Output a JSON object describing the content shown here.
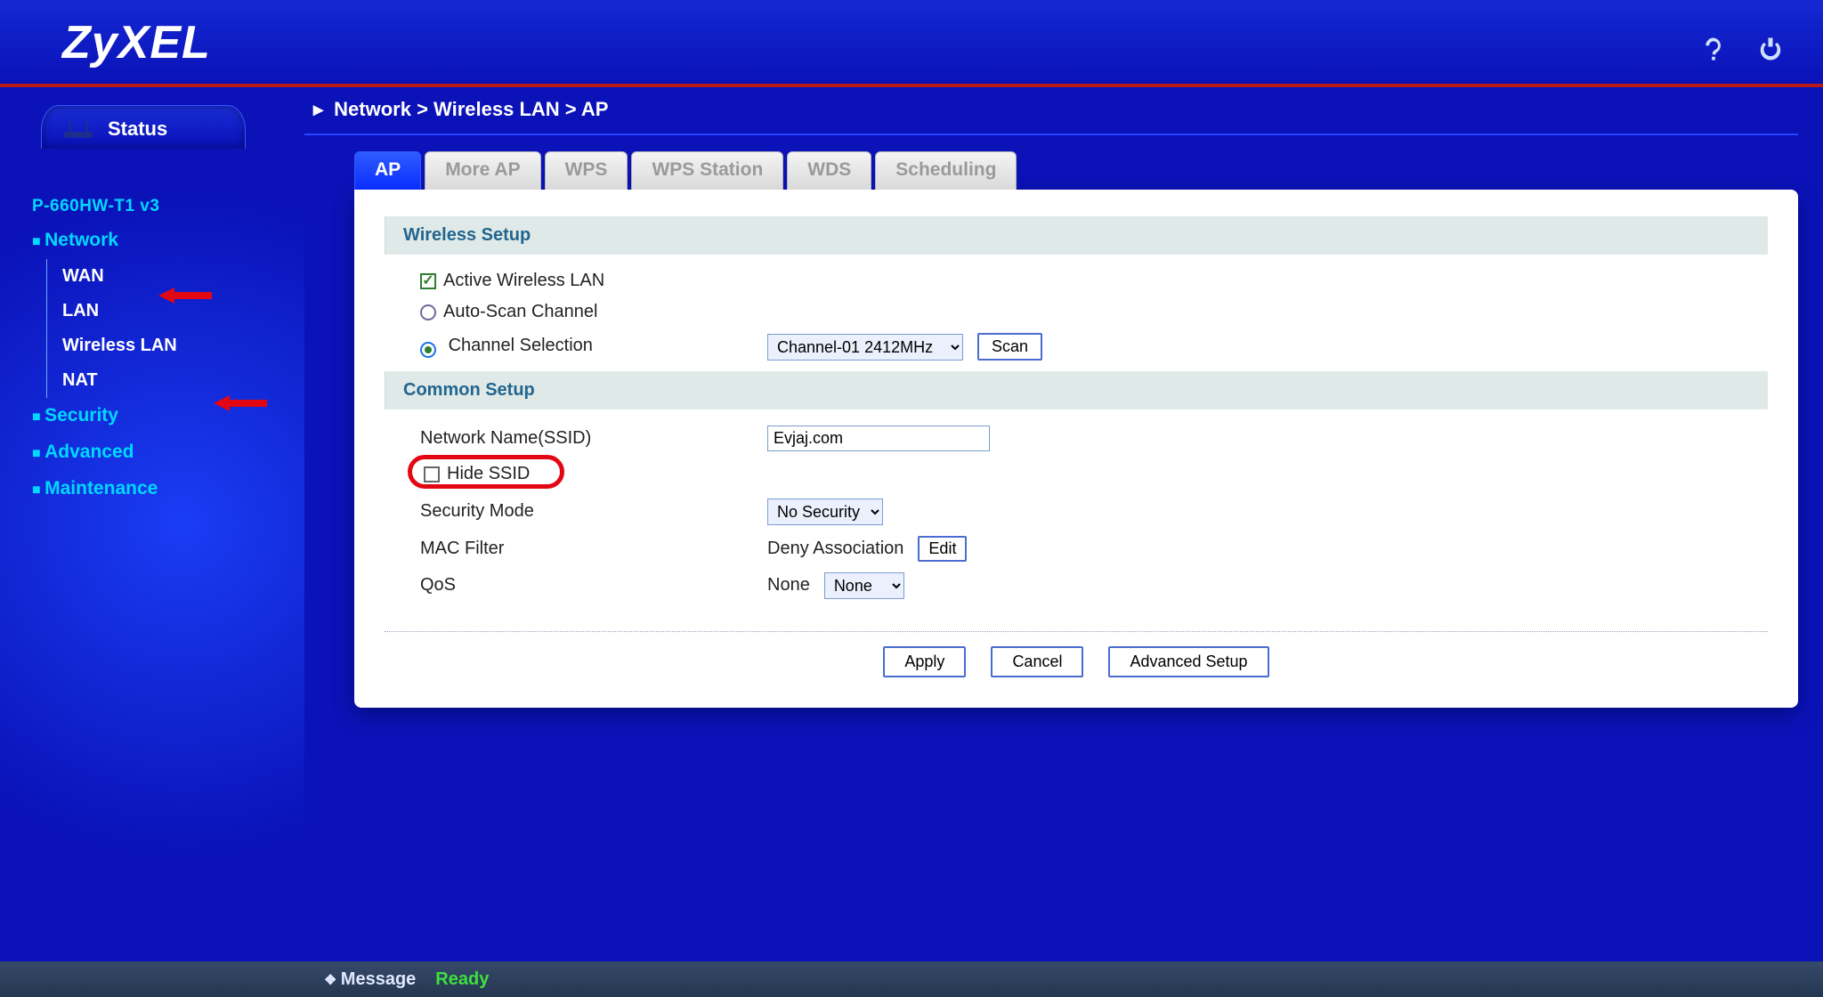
{
  "brand": "ZyXEL",
  "topbar": {
    "help_icon": "help-icon",
    "logout_icon": "logout-icon"
  },
  "sidebar": {
    "status_label": "Status",
    "device_model": "P-660HW-T1 v3",
    "items": [
      {
        "label": "Network",
        "children": [
          "WAN",
          "LAN",
          "Wireless LAN",
          "NAT"
        ]
      },
      {
        "label": "Security"
      },
      {
        "label": "Advanced"
      },
      {
        "label": "Maintenance"
      }
    ]
  },
  "breadcrumb": "Network > Wireless LAN > AP",
  "tabs": [
    "AP",
    "More AP",
    "WPS",
    "WPS Station",
    "WDS",
    "Scheduling"
  ],
  "active_tab": "AP",
  "sections": {
    "wireless_setup": {
      "title": "Wireless Setup",
      "active_wlan_label": "Active Wireless LAN",
      "active_wlan_checked": true,
      "auto_scan_label": "Auto-Scan Channel",
      "auto_scan_selected": false,
      "channel_sel_label": "Channel Selection",
      "channel_sel_selected": true,
      "channel_value": "Channel-01 2412MHz",
      "scan_btn": "Scan"
    },
    "common_setup": {
      "title": "Common Setup",
      "ssid_label": "Network Name(SSID)",
      "ssid_value": "Evjaj.com",
      "hide_ssid_label": "Hide SSID",
      "hide_ssid_checked": false,
      "sec_mode_label": "Security Mode",
      "sec_mode_value": "No Security",
      "mac_filter_label": "MAC Filter",
      "mac_filter_text": "Deny Association",
      "mac_filter_btn": "Edit",
      "qos_label": "QoS",
      "qos_text": "None",
      "qos_value": "None"
    }
  },
  "actions": {
    "apply": "Apply",
    "cancel": "Cancel",
    "advanced": "Advanced Setup"
  },
  "statusbar": {
    "label": "Message",
    "text": "Ready"
  }
}
